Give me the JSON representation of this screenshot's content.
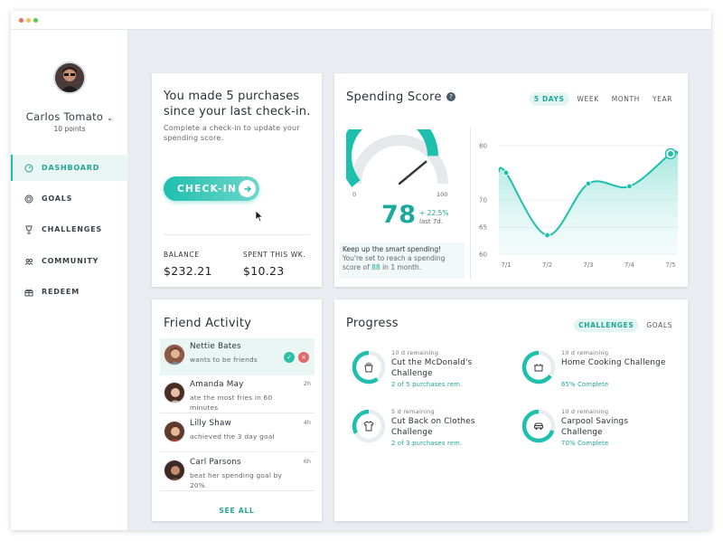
{
  "user": {
    "name": "Carlos Tomato",
    "points": "10 points"
  },
  "nav": [
    {
      "label": "DASHBOARD",
      "icon": "dashboard-icon"
    },
    {
      "label": "GOALS",
      "icon": "target-icon"
    },
    {
      "label": "CHALLENGES",
      "icon": "trophy-icon"
    },
    {
      "label": "COMMUNITY",
      "icon": "people-icon"
    },
    {
      "label": "REDEEM",
      "icon": "gift-icon"
    }
  ],
  "checkin": {
    "headline": "You made 5 purchases since your last check-in.",
    "subtext": "Complete a check-in to update your spending score.",
    "button_label": "CHECK-IN",
    "balance_label": "BALANCE",
    "balance_value": "$232.21",
    "spent_label": "SPENT THIS WK.",
    "spent_value": "$10.23"
  },
  "spending": {
    "title": "Spending Score",
    "help": "?",
    "tabs": [
      "5 DAYS",
      "WEEK",
      "MONTH",
      "YEAR"
    ],
    "active_tab": "5 DAYS",
    "score": "78",
    "change": "+ 22.5%",
    "change_sub": "last 7d.",
    "gauge_min": "0",
    "gauge_max": "100",
    "gauge_value": 78,
    "tip_title": "Keep up the smart spending!",
    "tip_text_before": "You're set to reach a spending score of",
    "tip_score": "88",
    "tip_text_after": "in 1 month.",
    "accent": "#1fbfae"
  },
  "chart_data": {
    "type": "line",
    "x": [
      "7/1",
      "7/2",
      "7/3",
      "7/4",
      "7/5"
    ],
    "values": [
      75,
      63.5,
      73,
      72.5,
      78.5
    ],
    "ylim": [
      60,
      80
    ],
    "yticks": [
      "80",
      "70",
      "65",
      "60"
    ],
    "ytick_values": [
      80,
      70,
      65,
      60
    ],
    "grid": true
  },
  "friends": {
    "title": "Friend Activity",
    "see_all": "SEE ALL",
    "items": [
      {
        "name": "Nettie Bates",
        "desc": "wants to be friends",
        "time": ""
      },
      {
        "name": "Amanda May",
        "desc": "ate the most fries in 60 minutes",
        "time": "2h"
      },
      {
        "name": "Lilly Shaw",
        "desc": "achieved the 3 day goal",
        "time": "4h"
      },
      {
        "name": "Carl Parsons",
        "desc": "beat her spending goal by 20%",
        "time": "6h"
      }
    ]
  },
  "progress": {
    "title": "Progress",
    "tabs": [
      "CHALLENGES",
      "GOALS"
    ],
    "active_tab": "CHALLENGES",
    "items": [
      {
        "remaining": "10 d remaining",
        "title": "Cut the McDonald's Challenge",
        "progress": "2 of 5 purchases rem.",
        "fraction": 0.6,
        "icon": "fries-icon"
      },
      {
        "remaining": "10 d remaining",
        "title": "Home Cooking Challenge",
        "progress": "65% Complete",
        "fraction": 0.65,
        "icon": "cooking-icon"
      },
      {
        "remaining": "5 d remaining",
        "title": "Cut Back on Clothes Challenge",
        "progress": "2 of 3 purchases rem.",
        "fraction": 0.33,
        "icon": "shirt-icon"
      },
      {
        "remaining": "10 d remaining",
        "title": "Carpool Savings Challenge",
        "progress": "70% Complete",
        "fraction": 0.7,
        "icon": "car-icon"
      }
    ]
  }
}
